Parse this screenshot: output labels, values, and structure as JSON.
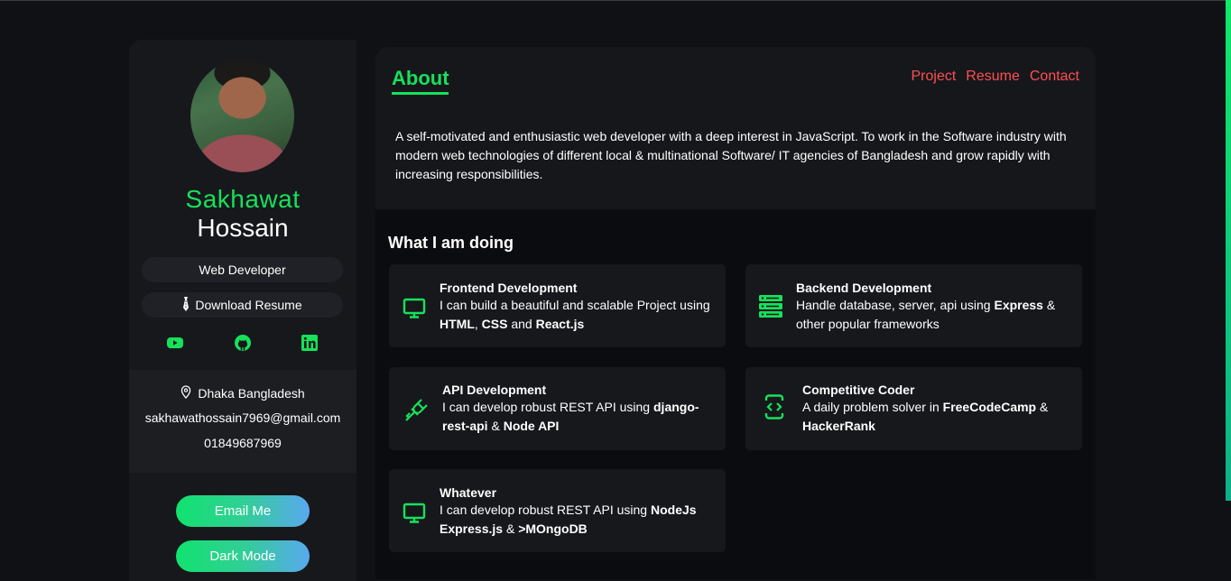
{
  "colors": {
    "accent": "#16e15b",
    "nav": "#fd4f52",
    "bg": "#101115"
  },
  "profile": {
    "first_name": "Sakhawat",
    "last_name": "Hossain",
    "title": "Web Developer",
    "download_label": "Download Resume"
  },
  "socials": [
    "youtube-icon",
    "github-icon",
    "linkedin-icon"
  ],
  "contact": {
    "location": "Dhaka Bangladesh",
    "email": "sakhawathossain7969@gmail.com",
    "phone": "01849687969"
  },
  "buttons": {
    "email": "Email Me",
    "dark": "Dark Mode"
  },
  "nav": {
    "active": "About",
    "items": [
      "Project",
      "Resume",
      "Contact"
    ]
  },
  "about": {
    "text": "A self-motivated and enthusiastic web developer with a deep interest in JavaScript. To work in the Software industry with modern web technologies of different local & multinational Software/ IT agencies of Bangladesh and grow rapidly with increasing responsibilities."
  },
  "doing": {
    "title": "What I am doing",
    "cards": [
      {
        "title": "Frontend Development",
        "icon": "monitor-icon",
        "parts": [
          "I can build a beautiful and scalable Project using ",
          "HTML",
          ", ",
          "CSS",
          " and ",
          "React.js"
        ]
      },
      {
        "title": "Backend Development",
        "icon": "server-icon",
        "parts": [
          "Handle database, server, api using ",
          "Express",
          " & other popular frameworks"
        ]
      },
      {
        "title": "API Development",
        "icon": "plug-icon",
        "parts": [
          "I can develop robust REST API using ",
          "django-rest-api",
          " & ",
          "Node API"
        ]
      },
      {
        "title": "Competitive Coder",
        "icon": "code-phone-icon",
        "parts": [
          "A daily problem solver in ",
          "FreeCodeCamp",
          " & ",
          "HackerRank"
        ]
      },
      {
        "title": "Whatever",
        "icon": "monitor-icon",
        "parts": [
          "I can develop robust REST API using ",
          "NodeJs Express.js",
          " & ",
          ">MOngoDB"
        ]
      }
    ]
  }
}
